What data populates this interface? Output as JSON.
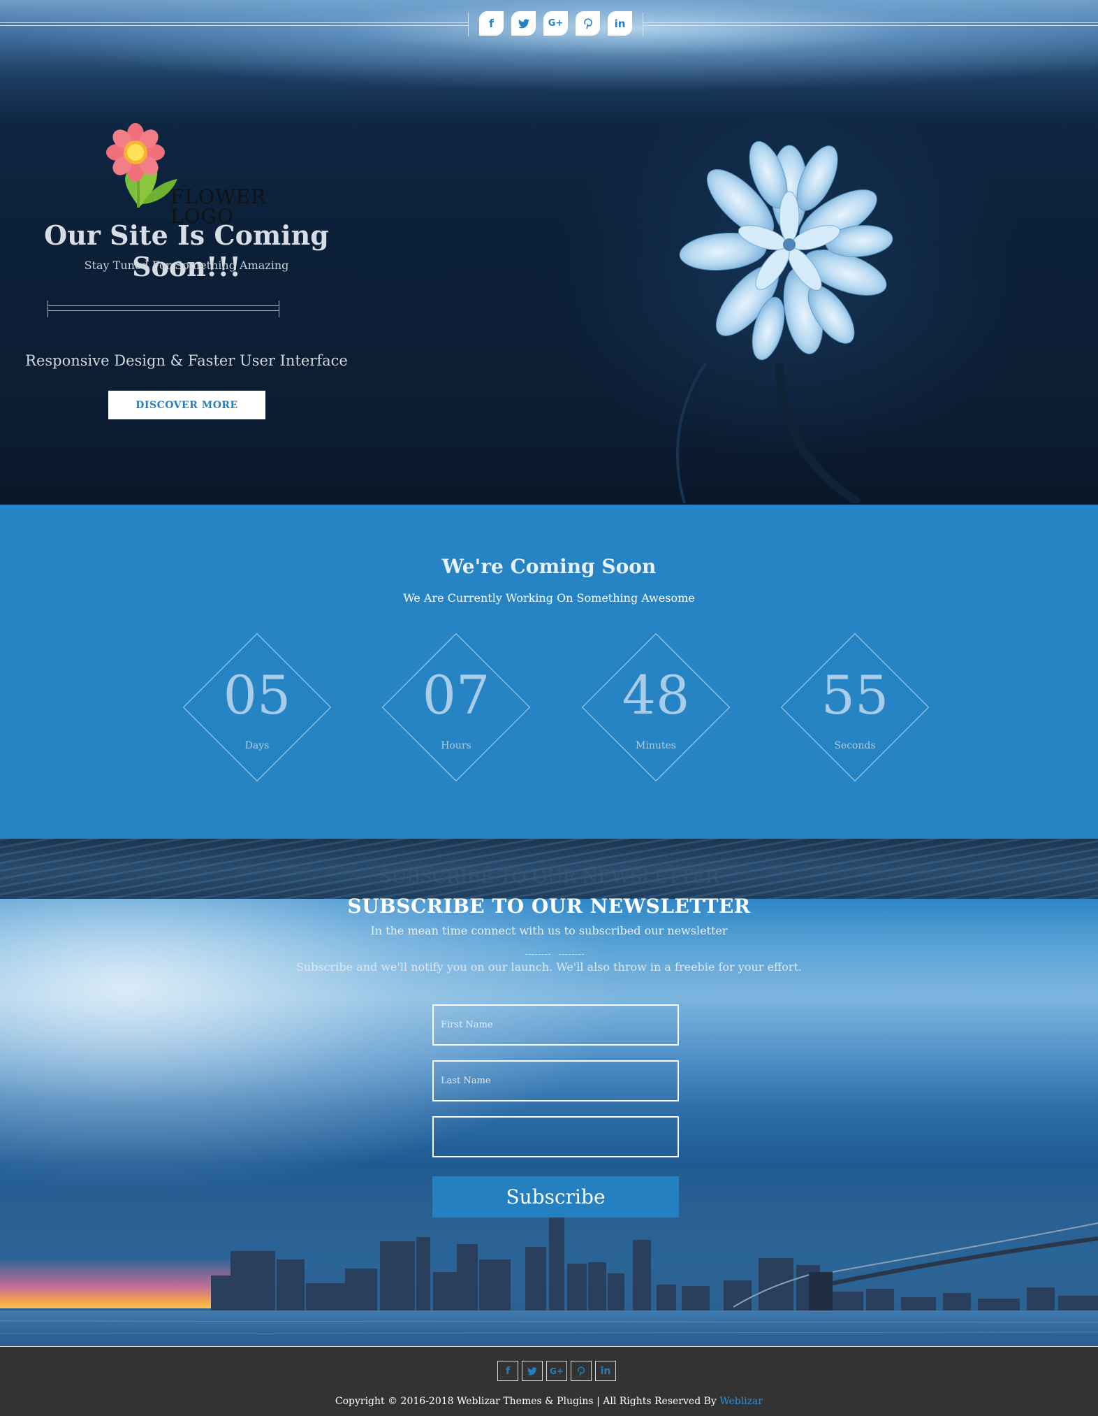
{
  "social": {
    "items": [
      {
        "icon": "facebook-icon",
        "glyph": "f"
      },
      {
        "icon": "twitter-icon",
        "glyph": "🐦"
      },
      {
        "icon": "google-plus-icon",
        "glyph": "G+"
      },
      {
        "icon": "pinterest-icon",
        "glyph": "P"
      },
      {
        "icon": "linkedin-icon",
        "glyph": "in"
      }
    ]
  },
  "hero": {
    "logo_text_line1": "FLOWER",
    "logo_text_line2": "LOGO",
    "title": "Our Site Is Coming Soon!!!",
    "subtitle": "Stay Tuned For Something Amazing",
    "tagline": "Responsive Design & Faster User Interface",
    "discover_label": "DISCOVER MORE"
  },
  "countdown": {
    "title": "We're Coming Soon",
    "subtitle": "We Are Currently Working On Something Awesome",
    "units": [
      {
        "value": "05",
        "label": "Days"
      },
      {
        "value": "07",
        "label": "Hours"
      },
      {
        "value": "48",
        "label": "Minutes"
      },
      {
        "value": "55",
        "label": "Seconds"
      }
    ]
  },
  "newsletter": {
    "ghost_title": "SUBSCRIBE TO OUR NEWSLETTER",
    "title": "SUBSCRIBE TO OUR NEWSLETTER",
    "subtitle": "In the mean time connect with us to subscribed our newsletter",
    "description": "Subscribe and we'll notify you on our launch. We'll also throw in a freebie for your effort.",
    "first_name_placeholder": "First Name",
    "last_name_placeholder": "Last Name",
    "email_placeholder": "",
    "subscribe_label": "Subscribe"
  },
  "footer": {
    "copyright_text": "Copyright © 2016-2018 Weblizar Themes & Plugins | All Rights Reserved By ",
    "copyright_link": "Weblizar"
  },
  "colors": {
    "accent": "#2580c2",
    "countdown_bg": "#2684c4",
    "footer_bg": "#333333"
  }
}
